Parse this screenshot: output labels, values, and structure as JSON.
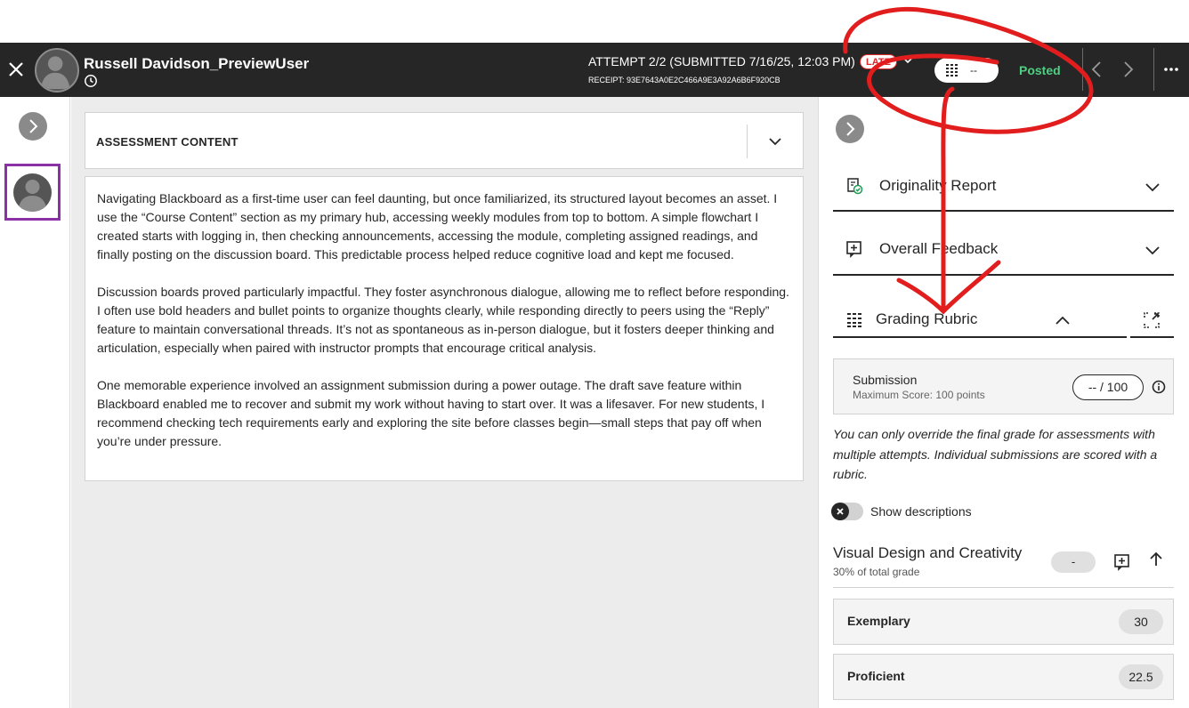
{
  "header": {
    "user_name": "Russell Davidson_PreviewUser",
    "attempt": "ATTEMPT 2/2 (SUBMITTED 7/16/25, 12:03 PM)",
    "late_badge": "LATE",
    "receipt": "RECEIPT: 93E7643A0E2C466A9E3A92A6B6F920CB",
    "grade_value": "--",
    "status": "Posted",
    "colors": {
      "bar": "#262626",
      "posted": "#4ed083",
      "late": "#d92a2a"
    }
  },
  "content": {
    "title": "ASSESSMENT CONTENT",
    "paragraphs": [
      "Navigating Blackboard as a first-time user can feel daunting, but once familiarized, its structured layout becomes an asset. I use the “Course Content” section as my primary hub, accessing weekly modules from top to bottom. A simple flowchart I created starts with logging in, then checking announcements, accessing the module, completing assigned readings, and finally posting on the discussion board. This predictable process helped reduce cognitive load and kept me focused.",
      "Discussion boards proved particularly impactful. They foster asynchronous dialogue, allowing me to reflect before responding. I often use bold headers and bullet points to organize thoughts clearly, while responding directly to peers using the “Reply” feature to maintain conversational threads. It’s not as spontaneous as in-person dialogue, but it fosters deeper thinking and articulation, especially when paired with instructor prompts that encourage critical analysis.",
      "One memorable experience involved an assignment submission during a power outage. The draft save feature within Blackboard enabled me to recover and submit my work without having to start over. It was a lifesaver. For new students, I recommend checking tech requirements early and exploring the site before classes begin—small steps that pay off when you’re under pressure."
    ]
  },
  "panel": {
    "sections": {
      "originality": "Originality Report",
      "feedback": "Overall Feedback",
      "rubric": "Grading Rubric"
    },
    "submission": {
      "label": "Submission",
      "max": "Maximum Score: 100 points",
      "score": "-- / 100"
    },
    "override_note": "You can only override the final grade for assessments with multiple attempts. Individual submissions are scored with a rubric.",
    "show_descriptions": "Show descriptions",
    "criterion": {
      "title": "Visual Design and Creativity",
      "weight": "30% of total grade",
      "score": "-"
    },
    "levels": [
      {
        "label": "Exemplary",
        "points": "30"
      },
      {
        "label": "Proficient",
        "points": "22.5"
      }
    ]
  }
}
